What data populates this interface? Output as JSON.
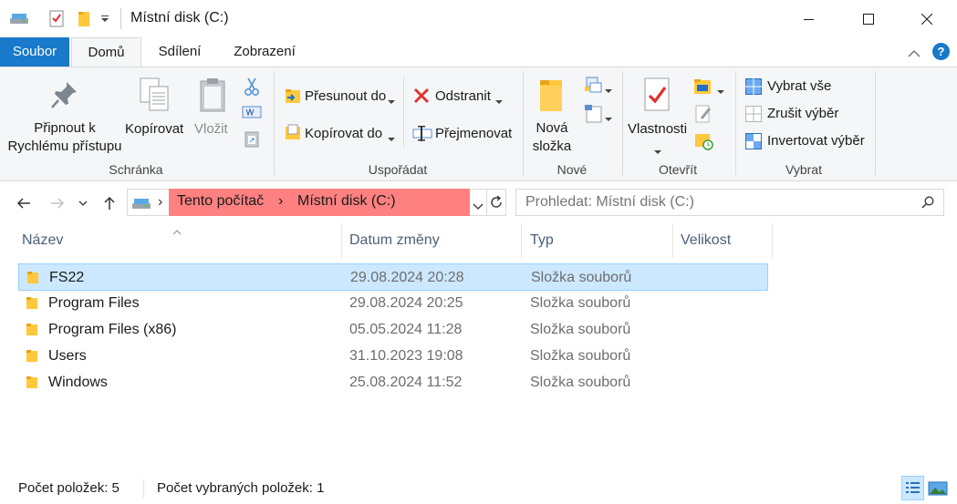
{
  "window": {
    "title": "Místní disk (C:)"
  },
  "ribbon_tabs": {
    "file": "Soubor",
    "home": "Domů",
    "share": "Sdílení",
    "view": "Zobrazení"
  },
  "clipboard": {
    "pin_line1": "Připnout k",
    "pin_line2": "Rychlému přístupu",
    "copy": "Kopírovat",
    "paste": "Vložit",
    "group": "Schránka"
  },
  "organize": {
    "move_to": "Přesunout do",
    "copy_to": "Kopírovat do",
    "delete": "Odstranit",
    "rename": "Přejmenovat",
    "group": "Uspořádat"
  },
  "new": {
    "folder_line1": "Nová",
    "folder_line2": "složka",
    "group": "Nové"
  },
  "open": {
    "properties": "Vlastnosti",
    "group": "Otevřít"
  },
  "select": {
    "select_all": "Vybrat vše",
    "select_none": "Zrušit výběr",
    "invert": "Invertovat výběr",
    "group": "Vybrat"
  },
  "address": {
    "crumb1": "Tento počítač",
    "crumb2": "Místní disk (C:)",
    "separator": "›"
  },
  "search": {
    "placeholder": "Prohledat: Místní disk (C:)"
  },
  "columns": {
    "name": "Název",
    "modified": "Datum změny",
    "type": "Typ",
    "size": "Velikost"
  },
  "files": [
    {
      "name": "FS22",
      "modified": "29.08.2024 20:28",
      "type": "Složka souborů",
      "selected": true
    },
    {
      "name": "Program Files",
      "modified": "29.08.2024 20:25",
      "type": "Složka souborů",
      "selected": false
    },
    {
      "name": "Program Files (x86)",
      "modified": "05.05.2024 11:28",
      "type": "Složka souborů",
      "selected": false
    },
    {
      "name": "Users",
      "modified": "31.10.2023 19:08",
      "type": "Složka souborů",
      "selected": false
    },
    {
      "name": "Windows",
      "modified": "25.08.2024 11:52",
      "type": "Složka souborů",
      "selected": false
    }
  ],
  "status": {
    "count": "Počet položek: 5",
    "selected": "Počet vybraných položek: 1"
  },
  "colors": {
    "accent": "#1979ca",
    "selection_bg": "#cce8ff",
    "address_highlight": "#ff8080",
    "folder": "#ffc83d"
  }
}
